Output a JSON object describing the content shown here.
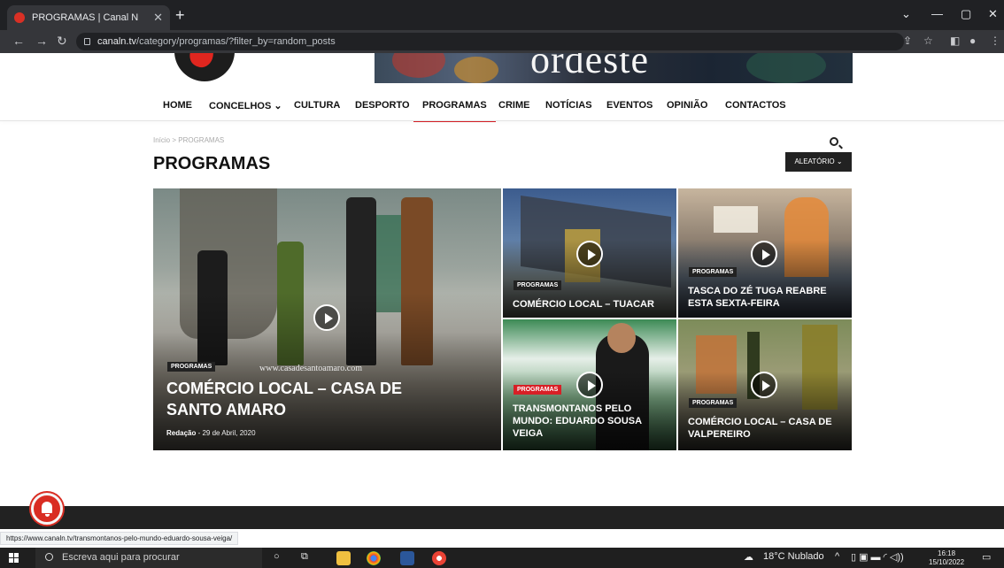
{
  "browser": {
    "tab_title": "PROGRAMAS | Canal N",
    "new_tab": "+",
    "url_domain": "canaln.tv",
    "url_path": "/category/programas/?filter_by=random_posts",
    "status_url": "https://www.canaln.tv/transmontanos-pelo-mundo-eduardo-sousa-veiga/"
  },
  "site": {
    "banner_text": "ordeste",
    "menu": [
      {
        "label": "HOME"
      },
      {
        "label": "CONCELHOS ⌄"
      },
      {
        "label": "CULTURA"
      },
      {
        "label": "DESPORTO"
      },
      {
        "label": "PROGRAMAS"
      },
      {
        "label": "CRIME"
      },
      {
        "label": "NOTÍCIAS"
      },
      {
        "label": "EVENTOS"
      },
      {
        "label": "OPINIÃO"
      },
      {
        "label": "CONTACTOS"
      }
    ],
    "breadcrumb": "Início  >  PROGRAMAS",
    "page_title": "PROGRAMAS",
    "sort_label": "ALEATÓRIO ⌄",
    "cards": [
      {
        "badge": "PROGRAMAS",
        "title": "COMÉRCIO LOCAL – CASA DE SANTO AMARO",
        "author": "Redação",
        "date": " - 29 de Abril, 2020",
        "watermark": "www.casadesantoamaro.com"
      },
      {
        "badge": "PROGRAMAS",
        "title": "COMÉRCIO LOCAL – TUACAR"
      },
      {
        "badge": "PROGRAMAS",
        "title": "TASCA DO ZÉ TUGA REABRE ESTA SEXTA-FEIRA"
      },
      {
        "badge": "PROGRAMAS",
        "title": "TRANSMONTANOS PELO MUNDO: EDUARDO SOUSA VEIGA"
      },
      {
        "badge": "PROGRAMAS",
        "title": "COMÉRCIO LOCAL – CASA DE VALPEREIRO"
      }
    ]
  },
  "taskbar": {
    "search_placeholder": "Escreva aqui para procurar",
    "weather": "18°C  Nublado",
    "time": "16:18",
    "date": "15/10/2022"
  },
  "colors": {
    "accent": "#d81f26",
    "chrome_dark": "#202124"
  }
}
